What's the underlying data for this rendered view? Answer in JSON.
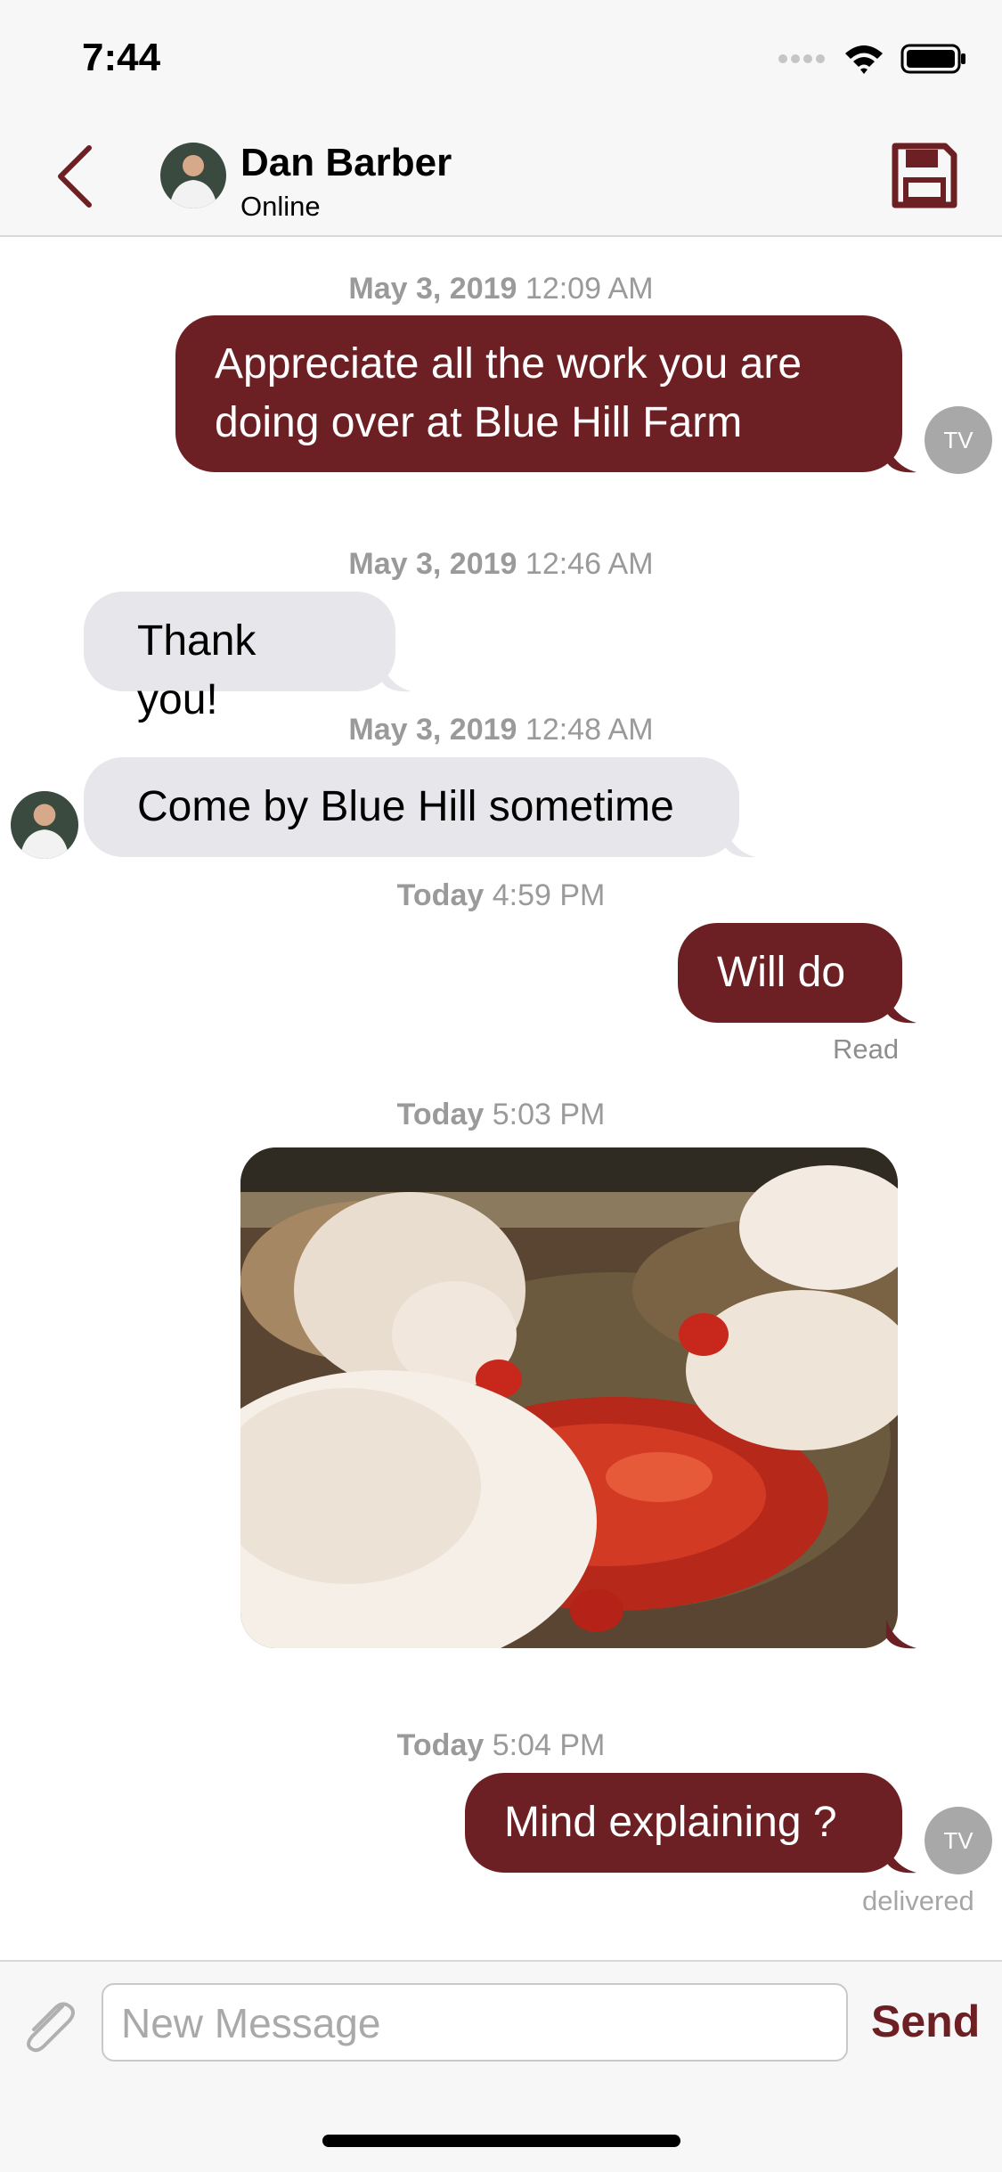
{
  "status_bar": {
    "time": "7:44"
  },
  "header": {
    "contact_name": "Dan Barber",
    "contact_status": "Online"
  },
  "messages": [
    {
      "date": "May 3, 2019",
      "time": "12:09 AM",
      "text": "Appreciate all the work you are doing over at Blue Hill Farm",
      "direction": "outgoing",
      "avatar": "TV"
    },
    {
      "date": "May 3, 2019",
      "time": "12:46 AM",
      "text": "Thank you!",
      "direction": "incoming"
    },
    {
      "date": "May 3, 2019",
      "time": "12:48 AM",
      "text": "Come by Blue Hill sometime",
      "direction": "incoming"
    },
    {
      "date": "Today",
      "time": "4:59 PM",
      "text": "Will do",
      "direction": "outgoing",
      "receipt": "Read"
    },
    {
      "date": "Today",
      "time": "5:03 PM",
      "direction": "outgoing",
      "type": "image"
    },
    {
      "date": "Today",
      "time": "5:04 PM",
      "text": "Mind explaining ?",
      "direction": "outgoing",
      "avatar": "TV",
      "receipt": "delivered"
    }
  ],
  "composer": {
    "placeholder": "New Message",
    "send_label": "Send"
  },
  "colors": {
    "accent": "#6d2024",
    "incoming_bubble": "#e6e6eb",
    "background": "#ffffff"
  }
}
